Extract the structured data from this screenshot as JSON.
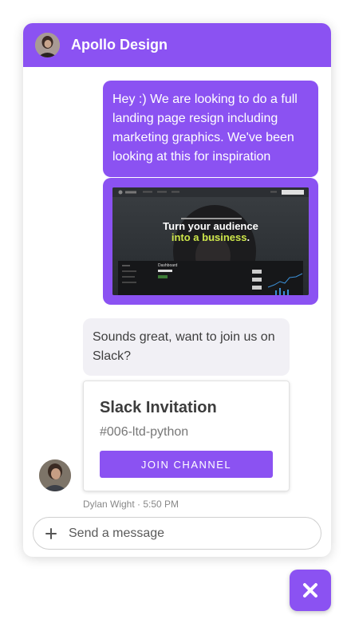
{
  "header": {
    "title": "Apollo Design",
    "avatar_icon": "user-avatar"
  },
  "messages": {
    "user_text": "Hey :) We are looking to do a full landing page resign including marketing graphics. We've been looking at this for inspiration",
    "agent_text": "Sounds great, want to join us on Slack?"
  },
  "attachment": {
    "headline_line1": "Turn your audience",
    "headline_line2_highlight": "into a business",
    "headline_line2_end": ".",
    "panel_title": "Dashboard"
  },
  "slack_card": {
    "title": "Slack Invitation",
    "channel": "#006-ltd-python",
    "button_label": "JOIN CHANNEL"
  },
  "meta": {
    "author_time": "Dylan Wight · 5:50 PM"
  },
  "composer": {
    "placeholder": "Send a message",
    "add_icon": "plus-icon"
  },
  "close_button": {
    "icon": "close-icon"
  },
  "colors": {
    "accent": "#8b52f2",
    "agent_bubble": "#f1f0f5"
  }
}
